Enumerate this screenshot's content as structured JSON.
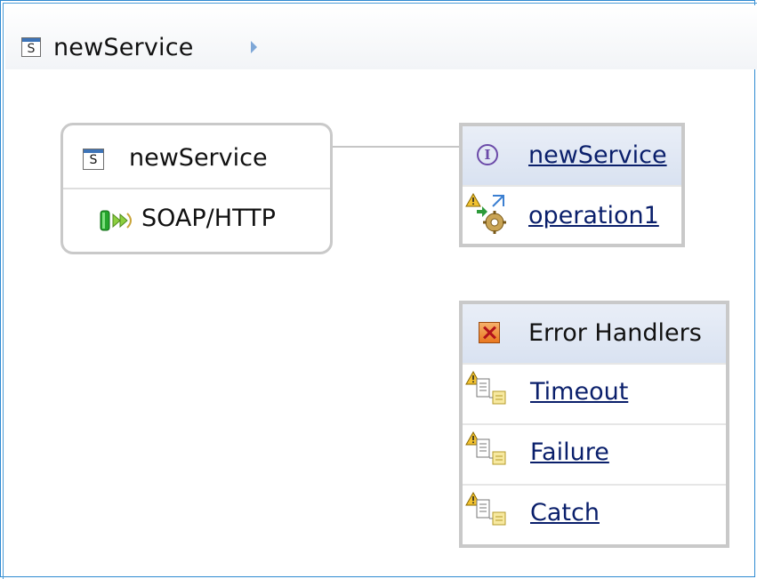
{
  "breadcrumb": {
    "icon": "service-icon",
    "icon_letter": "S",
    "title": "newService",
    "arrow_icon": "breadcrumb-arrow-icon"
  },
  "service_box": {
    "icon": "service-icon",
    "icon_letter": "S",
    "title": "newService",
    "binding": {
      "icon": "binding-icon",
      "label": "SOAP/HTTP"
    }
  },
  "interface_box": {
    "icon": "interface-icon",
    "icon_letter": "I",
    "title": "newService",
    "operation": {
      "icon": "operation-warning-icon",
      "label": "operation1"
    }
  },
  "error_handlers": {
    "icon": "error-handler-icon",
    "title": "Error Handlers",
    "items": [
      {
        "icon": "handler-warning-icon",
        "label": "Timeout"
      },
      {
        "icon": "handler-warning-icon",
        "label": "Failure"
      },
      {
        "icon": "handler-warning-icon",
        "label": "Catch"
      }
    ]
  },
  "colors": {
    "frame_border": "#2f8ad1",
    "link": "#0a1f6b",
    "header_fill": "#d9e2f1",
    "box_border": "#c9c9c9"
  }
}
